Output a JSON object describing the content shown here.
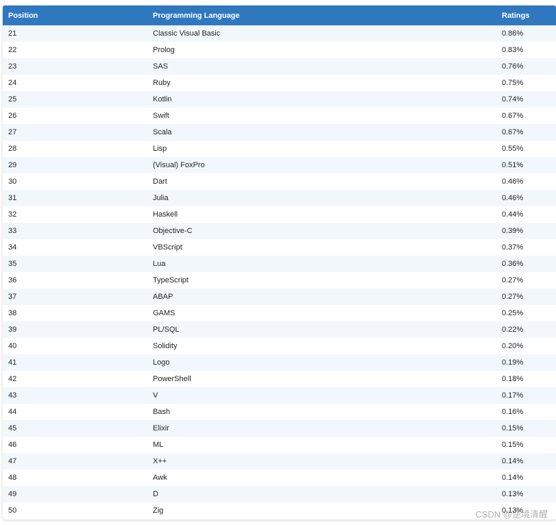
{
  "table": {
    "headers": {
      "position": "Position",
      "language": "Programming Language",
      "ratings": "Ratings"
    },
    "rows": [
      {
        "position": "21",
        "language": "Classic Visual Basic",
        "rating": "0.86%"
      },
      {
        "position": "22",
        "language": "Prolog",
        "rating": "0.83%"
      },
      {
        "position": "23",
        "language": "SAS",
        "rating": "0.76%"
      },
      {
        "position": "24",
        "language": "Ruby",
        "rating": "0.75%"
      },
      {
        "position": "25",
        "language": "Kotlin",
        "rating": "0.74%"
      },
      {
        "position": "26",
        "language": "Swift",
        "rating": "0.67%"
      },
      {
        "position": "27",
        "language": "Scala",
        "rating": "0.67%"
      },
      {
        "position": "28",
        "language": "Lisp",
        "rating": "0.55%"
      },
      {
        "position": "29",
        "language": "(Visual) FoxPro",
        "rating": "0.51%"
      },
      {
        "position": "30",
        "language": "Dart",
        "rating": "0.46%"
      },
      {
        "position": "31",
        "language": "Julia",
        "rating": "0.46%"
      },
      {
        "position": "32",
        "language": "Haskell",
        "rating": "0.44%"
      },
      {
        "position": "33",
        "language": "Objective-C",
        "rating": "0.39%"
      },
      {
        "position": "34",
        "language": "VBScript",
        "rating": "0.37%"
      },
      {
        "position": "35",
        "language": "Lua",
        "rating": "0.36%"
      },
      {
        "position": "36",
        "language": "TypeScript",
        "rating": "0.27%"
      },
      {
        "position": "37",
        "language": "ABAP",
        "rating": "0.27%"
      },
      {
        "position": "38",
        "language": "GAMS",
        "rating": "0.25%"
      },
      {
        "position": "39",
        "language": "PL/SQL",
        "rating": "0.22%"
      },
      {
        "position": "40",
        "language": "Solidity",
        "rating": "0.20%"
      },
      {
        "position": "41",
        "language": "Logo",
        "rating": "0.19%"
      },
      {
        "position": "42",
        "language": "PowerShell",
        "rating": "0.18%"
      },
      {
        "position": "43",
        "language": "V",
        "rating": "0.17%"
      },
      {
        "position": "44",
        "language": "Bash",
        "rating": "0.16%"
      },
      {
        "position": "45",
        "language": "Elixir",
        "rating": "0.15%"
      },
      {
        "position": "46",
        "language": "ML",
        "rating": "0.15%"
      },
      {
        "position": "47",
        "language": "X++",
        "rating": "0.14%"
      },
      {
        "position": "48",
        "language": "Awk",
        "rating": "0.14%"
      },
      {
        "position": "49",
        "language": "D",
        "rating": "0.13%"
      },
      {
        "position": "50",
        "language": "Zig",
        "rating": "0.13%"
      }
    ]
  },
  "watermark": "CSDN @逆境清醒",
  "colors": {
    "header_background": "#2f78bf",
    "header_text": "#ffffff",
    "row_stripe": "#f2f7fb",
    "row_plain": "#ffffff"
  }
}
